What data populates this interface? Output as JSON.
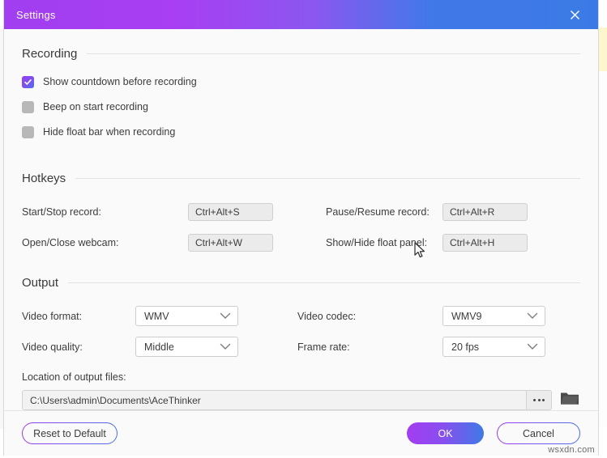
{
  "window": {
    "title": "Settings",
    "close_icon": "close-icon",
    "titlebar_gradient_from": "#a03ef0",
    "titlebar_gradient_to": "#3b7ae6"
  },
  "recording": {
    "heading": "Recording",
    "options": [
      {
        "label": "Show countdown before recording",
        "checked": true
      },
      {
        "label": "Beep on start recording",
        "checked": false
      },
      {
        "label": "Hide float bar when recording",
        "checked": false
      }
    ]
  },
  "hotkeys": {
    "heading": "Hotkeys",
    "items": [
      {
        "label": "Start/Stop record:",
        "value": "Ctrl+Alt+S"
      },
      {
        "label": "Pause/Resume record:",
        "value": "Ctrl+Alt+R"
      },
      {
        "label": "Open/Close webcam:",
        "value": "Ctrl+Alt+W"
      },
      {
        "label": "Show/Hide float panel:",
        "value": "Ctrl+Alt+H"
      }
    ]
  },
  "output": {
    "heading": "Output",
    "video_format": {
      "label": "Video format:",
      "value": "WMV"
    },
    "video_codec": {
      "label": "Video codec:",
      "value": "WMV9"
    },
    "video_quality": {
      "label": "Video quality:",
      "value": "Middle"
    },
    "frame_rate": {
      "label": "Frame rate:",
      "value": "20 fps"
    },
    "location": {
      "label": "Location of output files:",
      "value": "C:\\Users\\admin\\Documents\\AceThinker",
      "browse_icon": "ellipsis-icon",
      "folder_icon": "folder-icon"
    }
  },
  "footer": {
    "reset": "Reset to Default",
    "ok": "OK",
    "cancel": "Cancel",
    "accent_purple": "#9b3ced",
    "accent_blue": "#4b6fe8"
  },
  "watermark": "wsxdn.com"
}
